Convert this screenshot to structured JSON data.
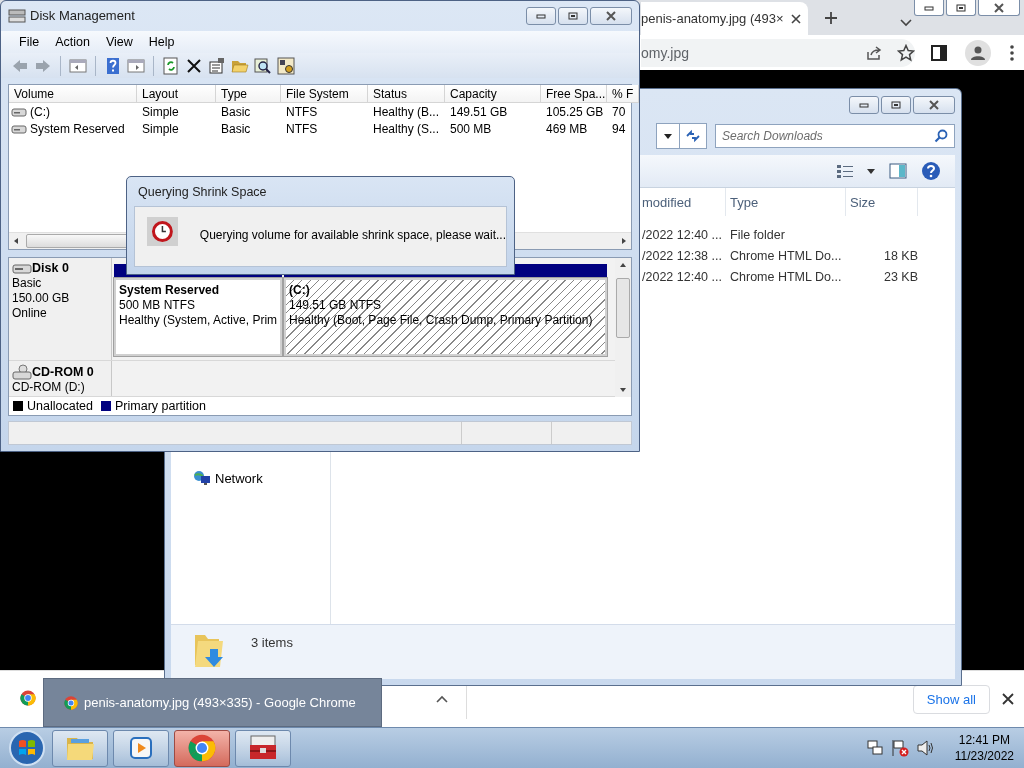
{
  "browser": {
    "tab_title": "penis-anatomy.jpg (493×",
    "address": "omy.jpg",
    "download_bar": {
      "show_all": "Show all"
    }
  },
  "explorer": {
    "search": {
      "placeholder": "Search Downloads"
    },
    "columns": [
      "modified",
      "Type",
      "Size"
    ],
    "rows": [
      {
        "date_modified": "/2022 12:40 ...",
        "type": "File folder",
        "size": ""
      },
      {
        "date_modified": "/2022 12:38 ...",
        "type": "Chrome HTML Do...",
        "size": "18 KB"
      },
      {
        "date_modified": "/2022 12:40 ...",
        "type": "Chrome HTML Do...",
        "size": "23 KB"
      }
    ],
    "nav_items": [
      {
        "label": "Network"
      }
    ],
    "status": "3 items"
  },
  "disk_management": {
    "title": "Disk Management",
    "menu": [
      "File",
      "Action",
      "View",
      "Help"
    ],
    "columns": [
      "Volume",
      "Layout",
      "Type",
      "File System",
      "Status",
      "Capacity",
      "Free Spa...",
      "% F"
    ],
    "volumes": [
      {
        "volume": "(C:)",
        "layout": "Simple",
        "type": "Basic",
        "file_system": "NTFS",
        "status": "Healthy (B...",
        "capacity": "149.51 GB",
        "free_space": "105.25 GB",
        "percent_free": "70"
      },
      {
        "volume": "System Reserved",
        "layout": "Simple",
        "type": "Basic",
        "file_system": "NTFS",
        "status": "Healthy (S...",
        "capacity": "500 MB",
        "free_space": "469 MB",
        "percent_free": "94"
      }
    ],
    "disks": [
      {
        "kind": "disk",
        "name": "Disk 0",
        "lines": [
          "Basic",
          "150.00 GB",
          "Online"
        ],
        "partitions": [
          {
            "name": "System Reserved",
            "size": "500 MB NTFS",
            "status": "Healthy (System, Active, Prim",
            "selected": false
          },
          {
            "name": "(C:)",
            "size": "149.51 GB NTFS",
            "status": "Healthy (Boot, Page File, Crash Dump, Primary Partition)",
            "selected": true
          }
        ]
      },
      {
        "kind": "cdrom",
        "name": "CD-ROM 0",
        "lines": [
          "CD-ROM (D:)"
        ]
      }
    ],
    "legend": [
      {
        "label": "Unallocated",
        "color": "#000000"
      },
      {
        "label": "Primary partition",
        "color": "#000080"
      }
    ]
  },
  "dialog": {
    "title": "Querying Shrink Space",
    "message": "Querying volume for available shrink space, please wait..."
  },
  "thumbnail": {
    "title": "penis-anatomy.jpg (493×335) - Google Chrome"
  },
  "taskbar": {
    "apps": [
      {
        "kind": "explorer",
        "selected": false
      },
      {
        "kind": "media",
        "selected": false
      },
      {
        "kind": "chrome",
        "selected": true
      },
      {
        "kind": "toolbox",
        "selected": false
      }
    ],
    "clock": {
      "time": "12:41 PM",
      "date": "11/23/2022"
    }
  }
}
